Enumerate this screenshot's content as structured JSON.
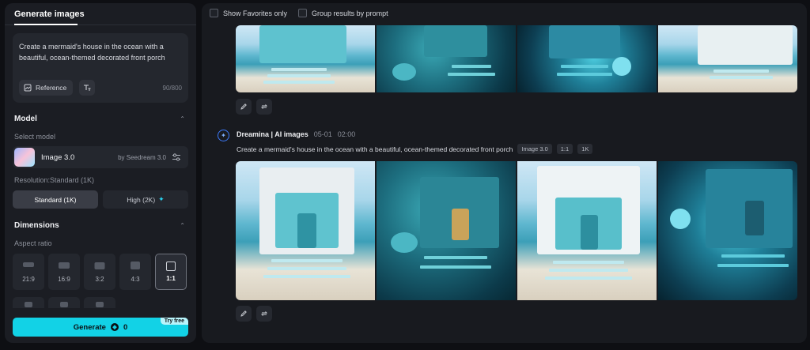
{
  "left_panel": {
    "tab": "Generate images",
    "prompt": {
      "text": "Create a mermaid's house in the ocean with a beautiful, ocean-themed decorated front porch",
      "reference_label": "Reference",
      "counter": "90/800"
    },
    "model": {
      "section_title": "Model",
      "select_label": "Select model",
      "name": "Image 3.0",
      "by": "by Seedream 3.0"
    },
    "resolution": {
      "label": "Resolution:Standard (1K)",
      "standard": "Standard (1K)",
      "high": "High (2K)",
      "high_icon": "sparkle-icon"
    },
    "dimensions": {
      "section_title": "Dimensions",
      "aspect_label": "Aspect ratio",
      "ratios": [
        "21:9",
        "16:9",
        "3:2",
        "4:3",
        "1:1"
      ],
      "selected": "1:1"
    },
    "generate": {
      "label": "Generate",
      "cost": "0",
      "badge": "Try free"
    }
  },
  "right_panel": {
    "filters": {
      "favorites": "Show Favorites only",
      "group": "Group results by prompt"
    },
    "generation": {
      "author": "Dreamina | AI images",
      "date": "05-01",
      "time": "02:00",
      "prompt": "Create a mermaid's house in the ocean with a beautiful, ocean-themed decorated front porch",
      "chips": [
        "Image 3.0",
        "1:1",
        "1K"
      ]
    }
  },
  "colors": {
    "accent": "#12d2e6",
    "panel": "#1b1d23",
    "background": "#0e0f13"
  }
}
